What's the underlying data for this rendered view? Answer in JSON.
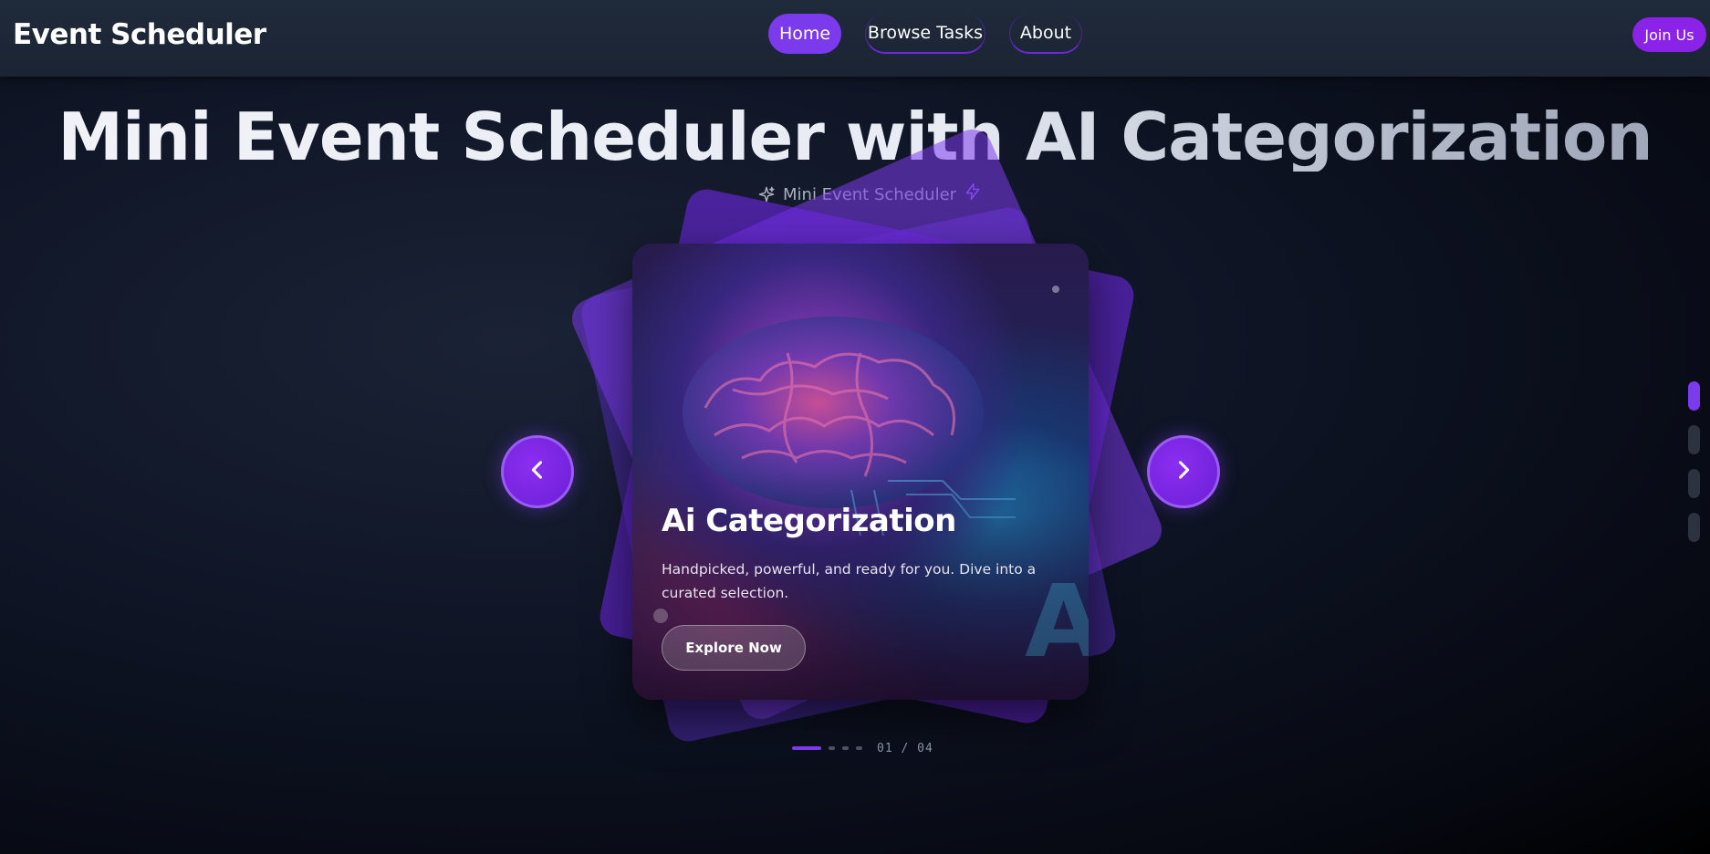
{
  "navbar": {
    "brand": "Event Scheduler",
    "links": [
      {
        "label": "Home",
        "active": true
      },
      {
        "label": "Browse Tasks",
        "active": false
      },
      {
        "label": "About",
        "active": false
      }
    ],
    "join_label": "Join Us"
  },
  "hero": {
    "title": "Mini Event Scheduler with AI Categorization",
    "subtitle": "Mini Event Scheduler",
    "subtitle_icons": [
      "sparkles-icon",
      "lightning-icon"
    ]
  },
  "carousel": {
    "current_card": {
      "title": "Ai Categorization",
      "description": "Handpicked, powerful, and ready for you. Dive into a curated selection.",
      "button_label": "Explore Now",
      "image": "ai-brain-circuit-image",
      "overlay_letter": "A"
    },
    "prev_icon": "chevron-left-icon",
    "next_icon": "chevron-right-icon",
    "pagination": {
      "current": 1,
      "total": 4,
      "label": "01 / 04"
    },
    "side_indicators": {
      "count": 4,
      "active_index": 0
    }
  },
  "colors": {
    "accent": "#7c3aed",
    "join_button": "#8b22e8",
    "navbar": "#1f2a3b",
    "background": "#0e1424"
  }
}
